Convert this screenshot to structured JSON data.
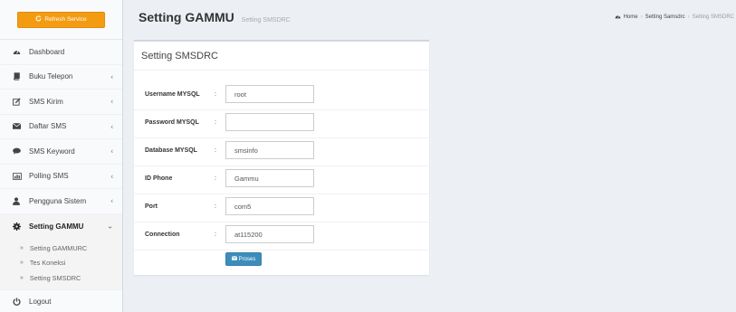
{
  "sidebar": {
    "refresh_label": "Refresh Service",
    "items": [
      {
        "label": "Dashboard",
        "icon": "dashboard-icon"
      },
      {
        "label": "Buku Telepon",
        "icon": "book-icon"
      },
      {
        "label": "SMS Kirim",
        "icon": "edit-icon"
      },
      {
        "label": "Daftar SMS",
        "icon": "envelope-icon"
      },
      {
        "label": "SMS Keyword",
        "icon": "comment-icon"
      },
      {
        "label": "Polling SMS",
        "icon": "chart-icon"
      },
      {
        "label": "Pengguna Sistem",
        "icon": "user-icon"
      },
      {
        "label": "Setting GAMMU",
        "icon": "gear-icon"
      }
    ],
    "submenu": [
      {
        "label": "Setting GAMMURC"
      },
      {
        "label": "Tes Koneksi"
      },
      {
        "label": "Setting SMSDRC"
      }
    ],
    "logout_label": "Logout"
  },
  "header": {
    "title": "Setting GAMMU",
    "subtitle": "Setting SMSDRC",
    "breadcrumb": [
      "Home",
      "Setting Samsdrc",
      "Setting SMSDRC"
    ]
  },
  "box": {
    "title": "Setting SMSDRC",
    "fields": [
      {
        "label": "Username MYSQL",
        "value": "root"
      },
      {
        "label": "Password MYSQL",
        "value": ""
      },
      {
        "label": "Database MYSQL",
        "value": "smsinfo"
      },
      {
        "label": "ID Phone",
        "value": "Gammu"
      },
      {
        "label": "Port",
        "value": "com5"
      },
      {
        "label": "Connection",
        "value": "at115200"
      }
    ],
    "colon": ":",
    "submit_label": "Proses"
  },
  "colors": {
    "accent_orange": "#f39c12",
    "primary_blue": "#3c8dbc"
  }
}
